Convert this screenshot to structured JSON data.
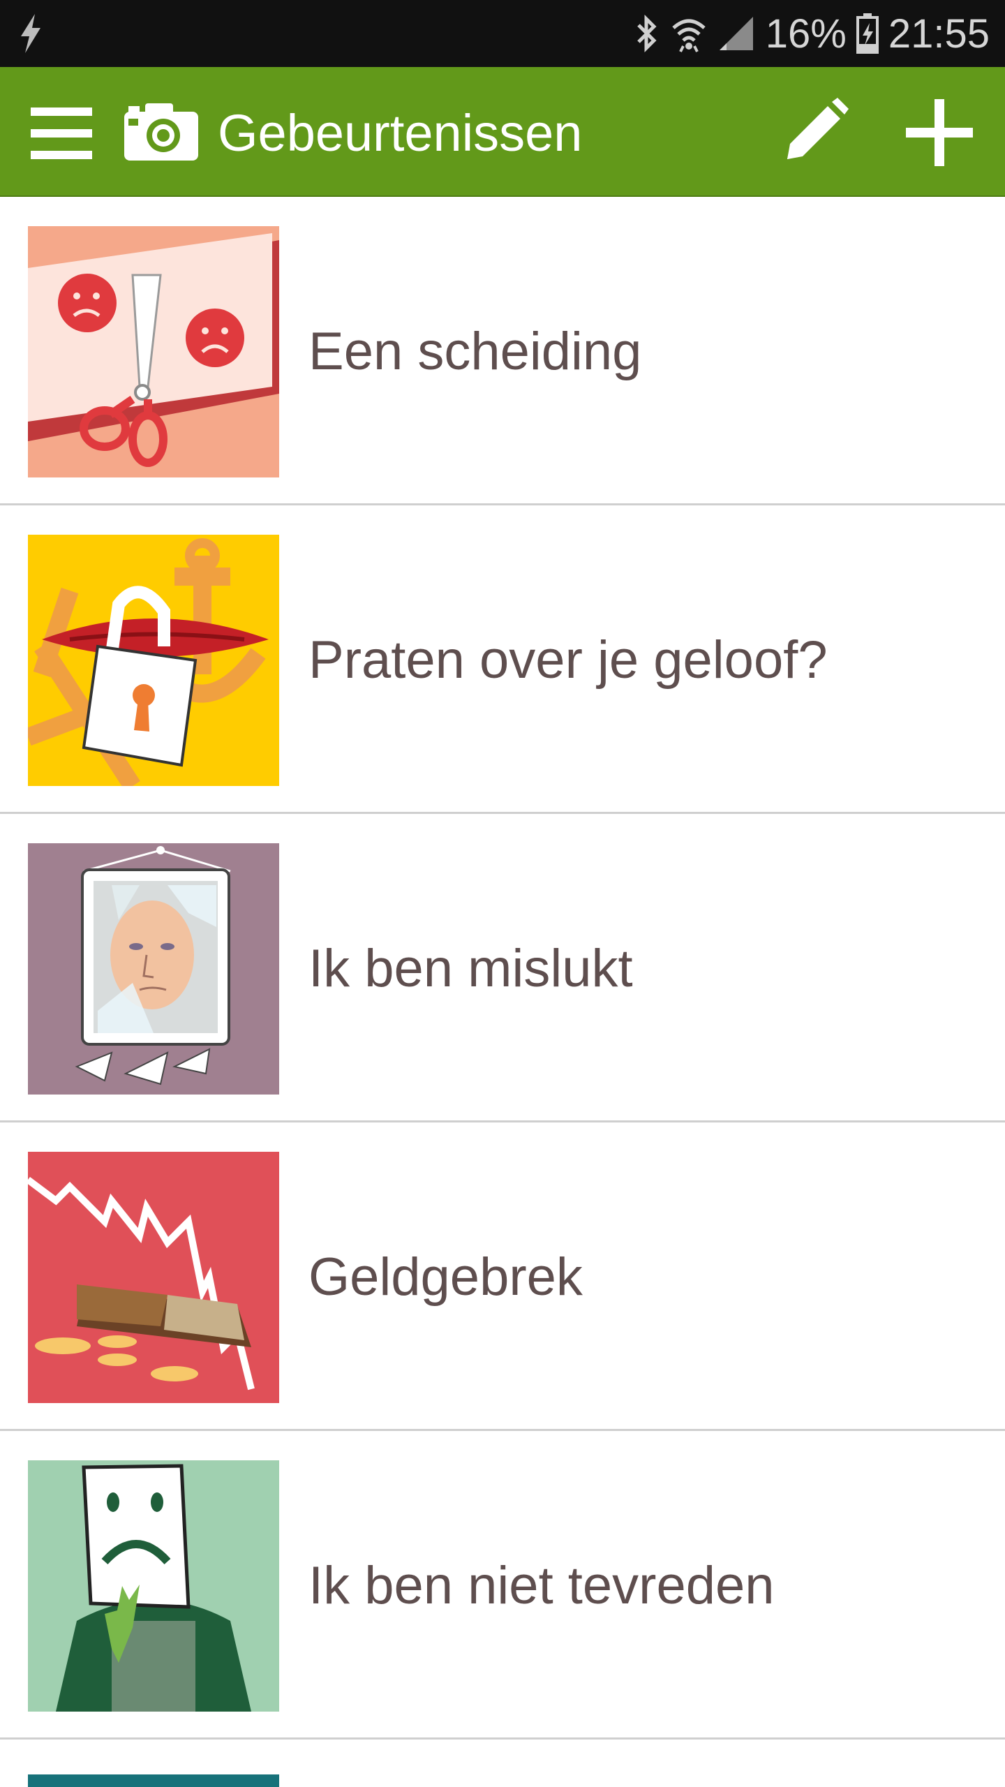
{
  "status_bar": {
    "battery": "16%",
    "time": "21:55",
    "icons": [
      "flash-icon",
      "bluetooth-icon",
      "wifi-icon",
      "signal-icon",
      "battery-charging-icon"
    ]
  },
  "app_bar": {
    "title": "Gebeurtenissen",
    "background": "#62991a",
    "icons": [
      "menu-icon",
      "camera-icon",
      "edit-icon",
      "add-icon"
    ]
  },
  "events": [
    {
      "label": "Een scheiding",
      "image": "torn-smiley-scissors-picture",
      "bg": "#f5a88a"
    },
    {
      "label": "Praten over je geloof?",
      "image": "locked-mouth-picture",
      "bg": "#ffcc00"
    },
    {
      "label": "Ik ben mislukt",
      "image": "broken-mirror-picture",
      "bg": "#a08090"
    },
    {
      "label": "Geldgebrek",
      "image": "empty-wallet-picture",
      "bg": "#e05058"
    },
    {
      "label": "Ik ben niet tevreden",
      "image": "sad-mask-picture",
      "bg": "#a0d0b0"
    }
  ]
}
